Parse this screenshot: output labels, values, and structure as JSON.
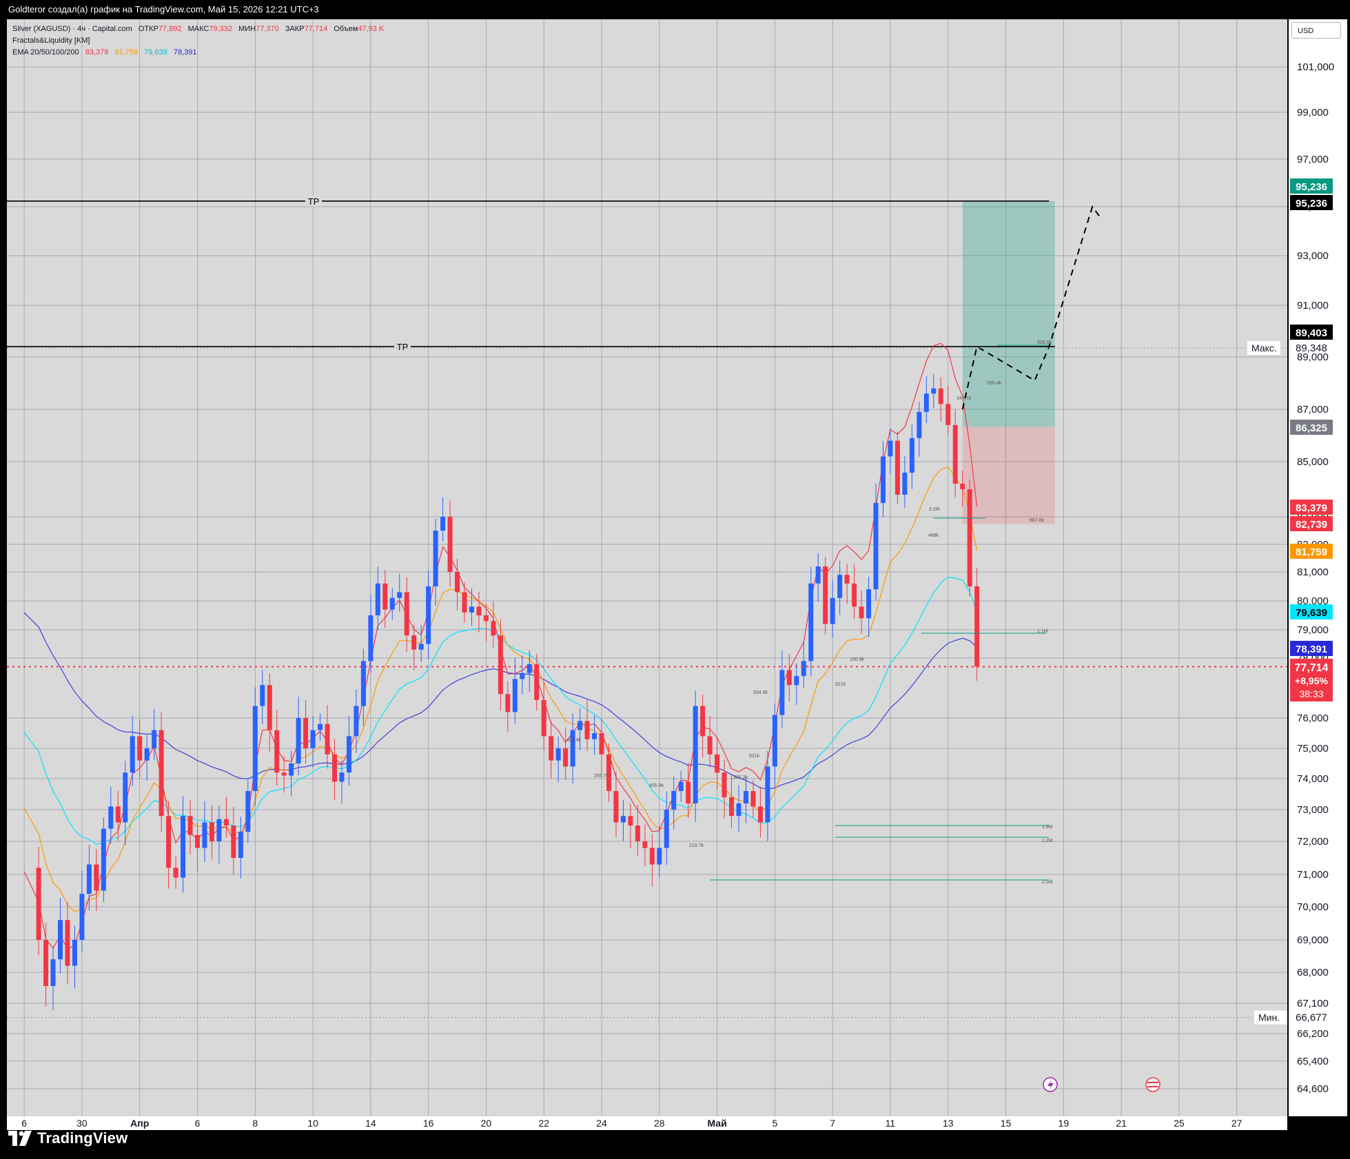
{
  "header": {
    "caption": "Goldteror создал(а) график на TradingView.com, Май 15, 2026 12:21 UTC+3"
  },
  "legend": {
    "symbol": "Silver (XAGUSD) · 4ч · Capital.com",
    "open_label": "ОТКР",
    "open": "77,892",
    "high_label": "МАКС",
    "high": "79,332",
    "low_label": "МИН",
    "low": "77,370",
    "close_label": "ЗАКР",
    "close": "77,714",
    "volume_label": "Объем",
    "volume": "47,93 K",
    "indicator1": "Fractals&Liquidity [KM]",
    "ema_label": "EMA 20/50/100/200",
    "ema20": "83,379",
    "ema50": "81,759",
    "ema100": "79,639",
    "ema200": "78,391"
  },
  "currency_button": "USD",
  "footer": {
    "brand": "TradingView"
  },
  "colors": {
    "background": "#d9d9d9",
    "grid": "#9598a1",
    "candle_up": "#2962ff",
    "candle_down": "#f23645",
    "ema20": "#f23645",
    "ema50": "#ff9800",
    "ema100": "#00e5ff",
    "ema200": "#3f3fe0",
    "profit_zone": "rgba(8,153,129,0.28)",
    "loss_zone": "rgba(242,54,69,0.18)"
  },
  "chart_data": {
    "type": "candlestick",
    "symbol": "Silver (XAGUSD)",
    "timeframe": "4ч",
    "ylim": [
      64.6,
      103.0
    ],
    "y_ticks": [
      "101,000",
      "99,000",
      "97,000",
      "95,000",
      "93,000",
      "91,000",
      "89,000",
      "87,000",
      "85,000",
      "83,000",
      "82,000",
      "81,000",
      "80,000",
      "79,000",
      "78,000",
      "76,000",
      "75,000",
      "74,000",
      "73,000",
      "72,000",
      "71,000",
      "70,000",
      "69,000",
      "68,000",
      "67,100",
      "66,200",
      "65,400",
      "64,600"
    ],
    "x_ticks": [
      {
        "label": "6",
        "day": -22
      },
      {
        "label": "30",
        "day": -18
      },
      {
        "label": "Апр",
        "day": -14
      },
      {
        "label": "6",
        "day": -10
      },
      {
        "label": "8",
        "day": -6
      },
      {
        "label": "10",
        "day": -2
      },
      {
        "label": "14",
        "day": 2
      },
      {
        "label": "16",
        "day": 6
      },
      {
        "label": "20",
        "day": 10
      },
      {
        "label": "22",
        "day": 14
      },
      {
        "label": "24",
        "day": 18
      },
      {
        "label": "28",
        "day": 22
      },
      {
        "label": "Май",
        "day": 26
      },
      {
        "label": "5",
        "day": 30
      },
      {
        "label": "7",
        "day": 34
      },
      {
        "label": "11",
        "day": 38
      },
      {
        "label": "13",
        "day": 42
      },
      {
        "label": "15",
        "day": 46
      },
      {
        "label": "19",
        "day": 50
      },
      {
        "label": "21",
        "day": 54
      },
      {
        "label": "25",
        "day": 58
      },
      {
        "label": "27",
        "day": 62
      }
    ],
    "price_path": [
      [
        -22.0,
        71.2
      ],
      [
        -21.0,
        69.0
      ],
      [
        -20.5,
        67.6
      ],
      [
        -20.0,
        68.4
      ],
      [
        -19.5,
        69.6
      ],
      [
        -19.0,
        68.2
      ],
      [
        -18.5,
        69.0
      ],
      [
        -18.0,
        70.4
      ],
      [
        -17.5,
        71.3
      ],
      [
        -17.0,
        70.5
      ],
      [
        -16.5,
        72.4
      ],
      [
        -16.0,
        73.1
      ],
      [
        -15.5,
        72.6
      ],
      [
        -15.0,
        74.2
      ],
      [
        -14.5,
        75.4
      ],
      [
        -14.0,
        74.6
      ],
      [
        -13.5,
        75.0
      ],
      [
        -13.0,
        75.6
      ],
      [
        -12.5,
        72.8
      ],
      [
        -12.0,
        71.2
      ],
      [
        -11.5,
        70.9
      ],
      [
        -11.0,
        72.8
      ],
      [
        -10.5,
        72.2
      ],
      [
        -10.0,
        71.8
      ],
      [
        -9.5,
        72.6
      ],
      [
        -9.0,
        72.0
      ],
      [
        -8.5,
        72.7
      ],
      [
        -8.0,
        72.5
      ],
      [
        -7.5,
        71.5
      ],
      [
        -7.0,
        72.3
      ],
      [
        -6.5,
        73.6
      ],
      [
        -6.0,
        76.4
      ],
      [
        -5.5,
        77.1
      ],
      [
        -5.0,
        75.6
      ],
      [
        -4.5,
        74.2
      ],
      [
        -4.0,
        74.1
      ],
      [
        -3.5,
        74.5
      ],
      [
        -3.0,
        76.0
      ],
      [
        -2.5,
        75.0
      ],
      [
        -2.0,
        75.6
      ],
      [
        -1.5,
        75.8
      ],
      [
        -1.0,
        74.8
      ],
      [
        -0.5,
        73.9
      ],
      [
        0.0,
        74.2
      ],
      [
        0.5,
        75.4
      ],
      [
        1.0,
        76.4
      ],
      [
        1.5,
        77.9
      ],
      [
        2.0,
        79.5
      ],
      [
        2.5,
        80.6
      ],
      [
        3.0,
        79.7
      ],
      [
        3.5,
        80.1
      ],
      [
        4.0,
        80.3
      ],
      [
        4.5,
        78.8
      ],
      [
        5.0,
        78.3
      ],
      [
        5.5,
        78.5
      ],
      [
        6.0,
        80.5
      ],
      [
        6.5,
        82.5
      ],
      [
        7.0,
        83.0
      ],
      [
        7.5,
        81.0
      ],
      [
        8.0,
        80.3
      ],
      [
        8.5,
        79.6
      ],
      [
        9.0,
        79.8
      ],
      [
        9.5,
        79.5
      ],
      [
        10.0,
        79.3
      ],
      [
        10.5,
        78.8
      ],
      [
        11.0,
        76.8
      ],
      [
        11.5,
        76.2
      ],
      [
        12.0,
        77.3
      ],
      [
        12.5,
        77.5
      ],
      [
        13.0,
        77.8
      ],
      [
        13.5,
        76.6
      ],
      [
        14.0,
        75.4
      ],
      [
        14.5,
        74.6
      ],
      [
        15.0,
        75.0
      ],
      [
        15.5,
        74.4
      ],
      [
        16.0,
        75.6
      ],
      [
        16.5,
        75.9
      ],
      [
        17.0,
        75.3
      ],
      [
        17.5,
        75.5
      ],
      [
        18.0,
        74.8
      ],
      [
        18.5,
        73.6
      ],
      [
        19.0,
        72.6
      ],
      [
        19.5,
        72.8
      ],
      [
        20.0,
        72.5
      ],
      [
        20.5,
        72.0
      ],
      [
        21.0,
        71.8
      ],
      [
        21.5,
        71.3
      ],
      [
        22.0,
        71.8
      ],
      [
        22.5,
        73.0
      ],
      [
        23.0,
        73.6
      ],
      [
        23.5,
        73.9
      ],
      [
        24.0,
        73.2
      ],
      [
        24.5,
        76.4
      ],
      [
        25.0,
        75.4
      ],
      [
        25.5,
        74.8
      ],
      [
        26.0,
        74.2
      ],
      [
        26.5,
        73.4
      ],
      [
        27.0,
        72.8
      ],
      [
        27.5,
        73.2
      ],
      [
        28.0,
        73.6
      ],
      [
        28.5,
        73.1
      ],
      [
        29.0,
        72.6
      ],
      [
        29.5,
        74.4
      ],
      [
        30.0,
        76.1
      ],
      [
        30.5,
        77.6
      ],
      [
        31.0,
        77.1
      ],
      [
        31.5,
        77.4
      ],
      [
        32.0,
        77.9
      ],
      [
        32.5,
        80.6
      ],
      [
        33.0,
        81.2
      ],
      [
        33.5,
        79.2
      ],
      [
        34.0,
        80.1
      ],
      [
        34.5,
        80.9
      ],
      [
        35.0,
        80.6
      ],
      [
        35.5,
        79.8
      ],
      [
        36.0,
        79.4
      ],
      [
        36.5,
        80.4
      ],
      [
        37.0,
        83.5
      ],
      [
        37.5,
        85.2
      ],
      [
        38.0,
        85.8
      ],
      [
        38.5,
        83.8
      ],
      [
        39.0,
        84.6
      ],
      [
        39.5,
        85.9
      ],
      [
        40.0,
        86.9
      ],
      [
        40.5,
        87.6
      ],
      [
        41.0,
        87.8
      ],
      [
        41.5,
        87.2
      ],
      [
        42.0,
        86.4
      ],
      [
        42.5,
        84.2
      ],
      [
        43.0,
        84.0
      ],
      [
        43.5,
        80.5
      ],
      [
        44.0,
        77.714
      ]
    ],
    "ema_values": {
      "ema20": 83.379,
      "ema50": 81.759,
      "ema100": 79.639,
      "ema200": 78.391
    },
    "tp_lines": [
      {
        "label": "TP",
        "price": 95.236
      },
      {
        "label": "TP",
        "price": 89.403
      }
    ],
    "position": {
      "entry": 86.325,
      "take_profit": 95.236,
      "stop_loss": 82.739
    },
    "projection": [
      [
        43.0,
        87.0
      ],
      [
        44.0,
        89.4
      ],
      [
        48.0,
        88.1
      ],
      [
        49.0,
        89.4
      ],
      [
        52.0,
        95.0
      ],
      [
        52.5,
        94.6
      ]
    ],
    "liquidity_labels": [
      "1.8M",
      "2.2M",
      "2.5M",
      "505.8k",
      "347.7k",
      "265.4k",
      "3.2M",
      "488k",
      "667.8k",
      "1.1M",
      "934.9k",
      "521k",
      "404.4k",
      "259.7k",
      "405.9k",
      "219.7k",
      "521k",
      "150.9k",
      "306.3k"
    ],
    "max_label": "Макс.",
    "max_value": "89,348",
    "min_label": "Мин.",
    "min_value": "66,677",
    "price_badges": [
      {
        "value": "95,236",
        "color": "#089981"
      },
      {
        "value": "95,236",
        "color": "#000000"
      },
      {
        "value": "89,403",
        "color": "#000000"
      },
      {
        "value": "86,325",
        "color": "#787b86"
      },
      {
        "value": "83,379",
        "color": "#f23645"
      },
      {
        "value": "82,739",
        "color": "#f23645"
      },
      {
        "value": "81,759",
        "color": "#ff9800"
      },
      {
        "value": "79,639",
        "color": "#00e5ff"
      },
      {
        "value": "78,391",
        "color": "#2929d6"
      }
    ],
    "last_price": {
      "value": "77,714",
      "change": "+8,95%",
      "timer": "38:33"
    },
    "xlim_days": [
      -23.2,
      65.5
    ],
    "x_axis_start_day": -22
  }
}
